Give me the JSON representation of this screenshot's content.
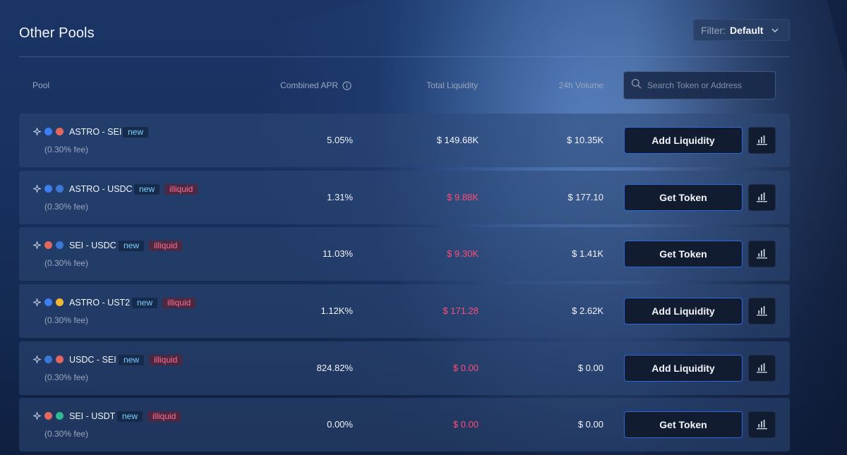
{
  "header": {
    "title": "Other Pools",
    "filter_label": "Filter:",
    "filter_value": "Default"
  },
  "table": {
    "columns": {
      "pool": "Pool",
      "apr": "Combined APR",
      "liquidity": "Total Liquidity",
      "volume": "24h Volume"
    },
    "search_placeholder": "Search Token or Address"
  },
  "colors": {
    "astro": "#3d7ef0",
    "sei": "#e2675f",
    "usdc": "#3a78d6",
    "ust2": "#f3b833",
    "usdt": "#2fb894",
    "illiquid_text": "#ff4d78",
    "new_text": "#7fcfff",
    "button_border": "#2f66d8"
  },
  "rows": [
    {
      "pair": "ASTRO - SEI",
      "tokens": [
        "astro",
        "sei"
      ],
      "badge_new": "new",
      "badge_illiquid": "",
      "fee": "(0.30% fee)",
      "apr": "5.05%",
      "liquidity": "$ 149.68K",
      "liquidity_illiquid": false,
      "volume": "$ 10.35K",
      "action": "Add Liquidity"
    },
    {
      "pair": "ASTRO - USDC",
      "tokens": [
        "astro",
        "usdc"
      ],
      "badge_new": "new",
      "badge_illiquid": "illiquid",
      "fee": "(0.30% fee)",
      "apr": "1.31%",
      "liquidity": "$ 9.88K",
      "liquidity_illiquid": true,
      "volume": "$ 177.10",
      "action": "Get Token"
    },
    {
      "pair": "SEI - USDC",
      "tokens": [
        "sei",
        "usdc"
      ],
      "badge_new": "new",
      "badge_illiquid": "illiquid",
      "fee": "(0.30% fee)",
      "apr": "11.03%",
      "liquidity": "$ 9.30K",
      "liquidity_illiquid": true,
      "volume": "$ 1.41K",
      "action": "Get Token"
    },
    {
      "pair": "ASTRO - UST2",
      "tokens": [
        "astro",
        "ust2"
      ],
      "badge_new": "new",
      "badge_illiquid": "illiquid",
      "fee": "(0.30% fee)",
      "apr": "1.12K%",
      "liquidity": "$ 171.28",
      "liquidity_illiquid": true,
      "volume": "$ 2.62K",
      "action": "Add Liquidity"
    },
    {
      "pair": "USDC - SEI",
      "tokens": [
        "usdc",
        "sei"
      ],
      "badge_new": "new",
      "badge_illiquid": "illiquid",
      "fee": "(0.30% fee)",
      "apr": "824.82%",
      "liquidity": "$ 0.00",
      "liquidity_illiquid": true,
      "volume": "$ 0.00",
      "action": "Add Liquidity"
    },
    {
      "pair": "SEI - USDT",
      "tokens": [
        "sei",
        "usdt"
      ],
      "badge_new": "new",
      "badge_illiquid": "illiquid",
      "fee": "(0.30% fee)",
      "apr": "0.00%",
      "liquidity": "$ 0.00",
      "liquidity_illiquid": true,
      "volume": "$ 0.00",
      "action": "Get Token"
    }
  ]
}
